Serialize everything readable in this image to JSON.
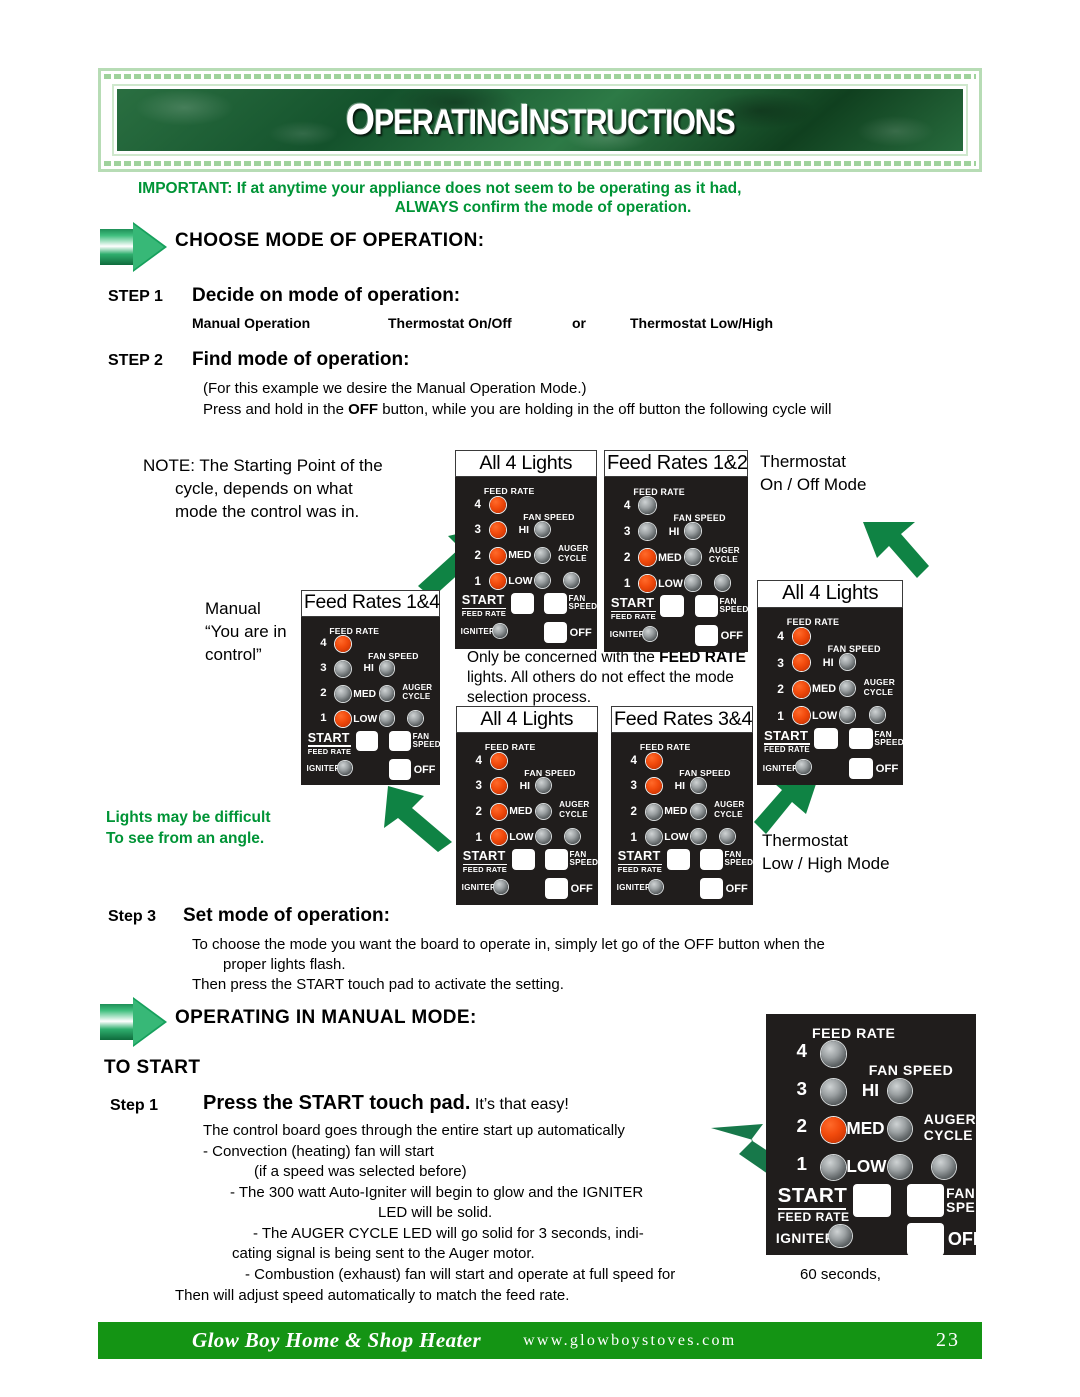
{
  "header": {
    "title_caps": "OI",
    "title": "OPERATING INSTRUCTIONS",
    "title_part1_cap": "O",
    "title_part1": "PERATING",
    "title_part2_cap": "I",
    "title_part2": "NSTRUCTIONS"
  },
  "important": {
    "line1": "IMPORTANT:  If at anytime your appliance does not seem to be operating as it had,",
    "line2": "ALWAYS confirm the mode of operation."
  },
  "sections": {
    "choose_mode": "CHOOSE  MODE OF OPERATION:",
    "operating_manual": "OPERATING IN MANUAL MODE:",
    "to_start": "TO START"
  },
  "step1": {
    "label": "STEP 1",
    "title": "Decide on mode of operation:",
    "opt1": "Manual Operation",
    "opt2": "Thermostat On/Off",
    "opt_or": "or",
    "opt3": "Thermostat Low/High"
  },
  "step2": {
    "label": "STEP 2",
    "title": "Find mode of operation:",
    "line1": "(For this example we desire the Manual Operation Mode.)",
    "line2_a": "Press and hold in the ",
    "line2_b": "OFF",
    "line2_c": " button, while you are holding in the off button the following cycle will"
  },
  "step3": {
    "label": "Step 3",
    "title": "Set mode of operation:",
    "line1": "To choose the mode you want the board to operate in, simply let go of the OFF button when the",
    "line2": "proper lights flash.",
    "line3": "Then press the START touch pad to activate the setting."
  },
  "start_step": {
    "label": "Step 1",
    "title_bold": "Press the START touch pad.",
    "title_rest": " It’s that easy!",
    "l1": "The control board goes through the entire start up automatically",
    "l2": "- Convection (heating) fan will start",
    "l3": "(if a speed was selected before)",
    "l4": "- The 300 watt Auto-Igniter will begin to glow and the IGNITER",
    "l5": "LED will be solid.",
    "l6": "- The AUGER CYCLE LED will go solid for 3 seconds, indi-",
    "l7": "cating      signal is being sent to the Auger motor.",
    "l8": "- Combustion (exhaust) fan will start and operate at full speed for",
    "l8b": "60 seconds,",
    "l9": "Then will adjust speed automatically to match the feed rate."
  },
  "diagram": {
    "note": {
      "l1": "NOTE: The Starting Point of the",
      "l2": "cycle, depends on what",
      "l3": "mode the control was in."
    },
    "manual": {
      "l1": "Manual",
      "l2": "“You are in",
      "l3": "control”"
    },
    "feedrate_note": {
      "l1_a": "Only be concerned with the ",
      "l1_b": "FEED RATE",
      "l2": "lights.  All others do not effect the mode",
      "l3": "selection process."
    },
    "lights_angle": {
      "l1": "Lights may be difficult",
      "l2": "To see from an angle."
    },
    "thermo_onoff": {
      "l1": "Thermostat",
      "l2": "On / Off Mode"
    },
    "thermo_lowhigh": {
      "l1": "Thermostat",
      "l2": "Low / High Mode"
    }
  },
  "panel_labels": {
    "feed_rate": "FEED RATE",
    "fan_speed": "FAN SPEED",
    "auger": "AUGER",
    "cycle": "CYCLE",
    "hi": "HI",
    "med": "MED",
    "low": "LOW",
    "start": "START",
    "start_sub": "FEED RATE",
    "fan": "FAN",
    "speed": "SPEED",
    "igniter": "IGNITER",
    "off": "OFF",
    "n4": "4",
    "n3": "3",
    "n2": "2",
    "n1": "1"
  },
  "panels": [
    {
      "caption": "All 4 Lights",
      "feed": [
        true,
        true,
        true,
        true
      ]
    },
    {
      "caption": "Feed Rates 1&2",
      "feed": [
        true,
        true,
        false,
        false
      ]
    },
    {
      "caption": "Feed Rates 1&4",
      "feed": [
        true,
        false,
        false,
        true
      ]
    },
    {
      "caption": "All 4 Lights",
      "feed": [
        true,
        true,
        true,
        true
      ]
    },
    {
      "caption": "Feed Rates 3&4",
      "feed": [
        false,
        false,
        true,
        true
      ]
    },
    {
      "caption": "All 4 Lights",
      "feed": [
        true,
        true,
        true,
        true
      ]
    }
  ],
  "big_panel": {
    "feed": [
      false,
      true,
      false,
      false
    ]
  },
  "footer": {
    "brand": "Glow Boy  Home & Shop Heater",
    "site": "www.glowboystoves.com",
    "page": "23"
  },
  "colors": {
    "green_accent": "#009436",
    "footer_green": "#149414",
    "led_on": "#f24b0d",
    "board": "#201d1c"
  }
}
